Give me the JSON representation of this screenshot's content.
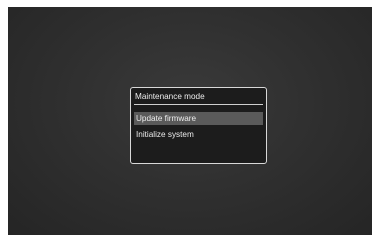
{
  "dialog": {
    "title": "Maintenance mode",
    "items": [
      {
        "label": "Update firmware",
        "selected": true
      },
      {
        "label": "Initialize system",
        "selected": false
      }
    ]
  },
  "colors": {
    "background": "#2f2f2f",
    "dialog_bg": "#1c1c1c",
    "highlight": "#5a5a5a",
    "text": "#ededed"
  }
}
